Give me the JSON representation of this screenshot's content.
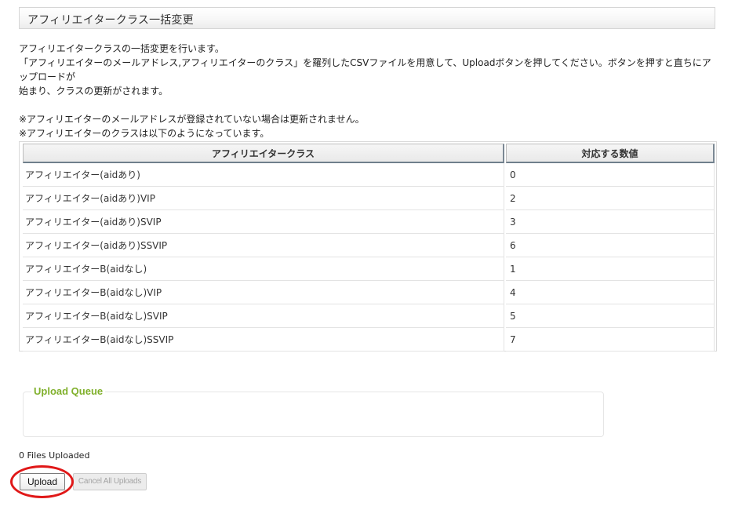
{
  "header": {
    "title": "アフィリエイタークラス一括変更"
  },
  "description": {
    "line1": "アフィリエイタークラスの一括変更を行います。",
    "line2": "「アフィリエイターのメールアドレス,アフィリエイターのクラス」を羅列したCSVファイルを用意して、Uploadボタンを押してください。ボタンを押すと直ちにアップロードが",
    "line3": "始まり、クラスの更新がされます。",
    "note1": "※アフィリエイターのメールアドレスが登録されていない場合は更新されません。",
    "note2": "※アフィリエイターのクラスは以下のようになっています。"
  },
  "table": {
    "headers": [
      "アフィリエイタークラス",
      "対応する数値"
    ],
    "rows": [
      {
        "cls": "アフィリエイター(aidあり)",
        "value": "0"
      },
      {
        "cls": "アフィリエイター(aidあり)VIP",
        "value": "2"
      },
      {
        "cls": "アフィリエイター(aidあり)SVIP",
        "value": "3"
      },
      {
        "cls": "アフィリエイター(aidあり)SSVIP",
        "value": "6"
      },
      {
        "cls": "アフィリエイターB(aidなし)",
        "value": "1"
      },
      {
        "cls": "アフィリエイターB(aidなし)VIP",
        "value": "4"
      },
      {
        "cls": "アフィリエイターB(aidなし)SVIP",
        "value": "5"
      },
      {
        "cls": "アフィリエイターB(aidなし)SSVIP",
        "value": "7"
      }
    ]
  },
  "upload": {
    "queue_title": "Upload Queue",
    "files_uploaded": "0 Files Uploaded",
    "upload_label": "Upload",
    "cancel_label": "Cancel All Uploads"
  },
  "colors": {
    "queue_title": "#80b02c",
    "highlight_ring": "#e01818"
  }
}
